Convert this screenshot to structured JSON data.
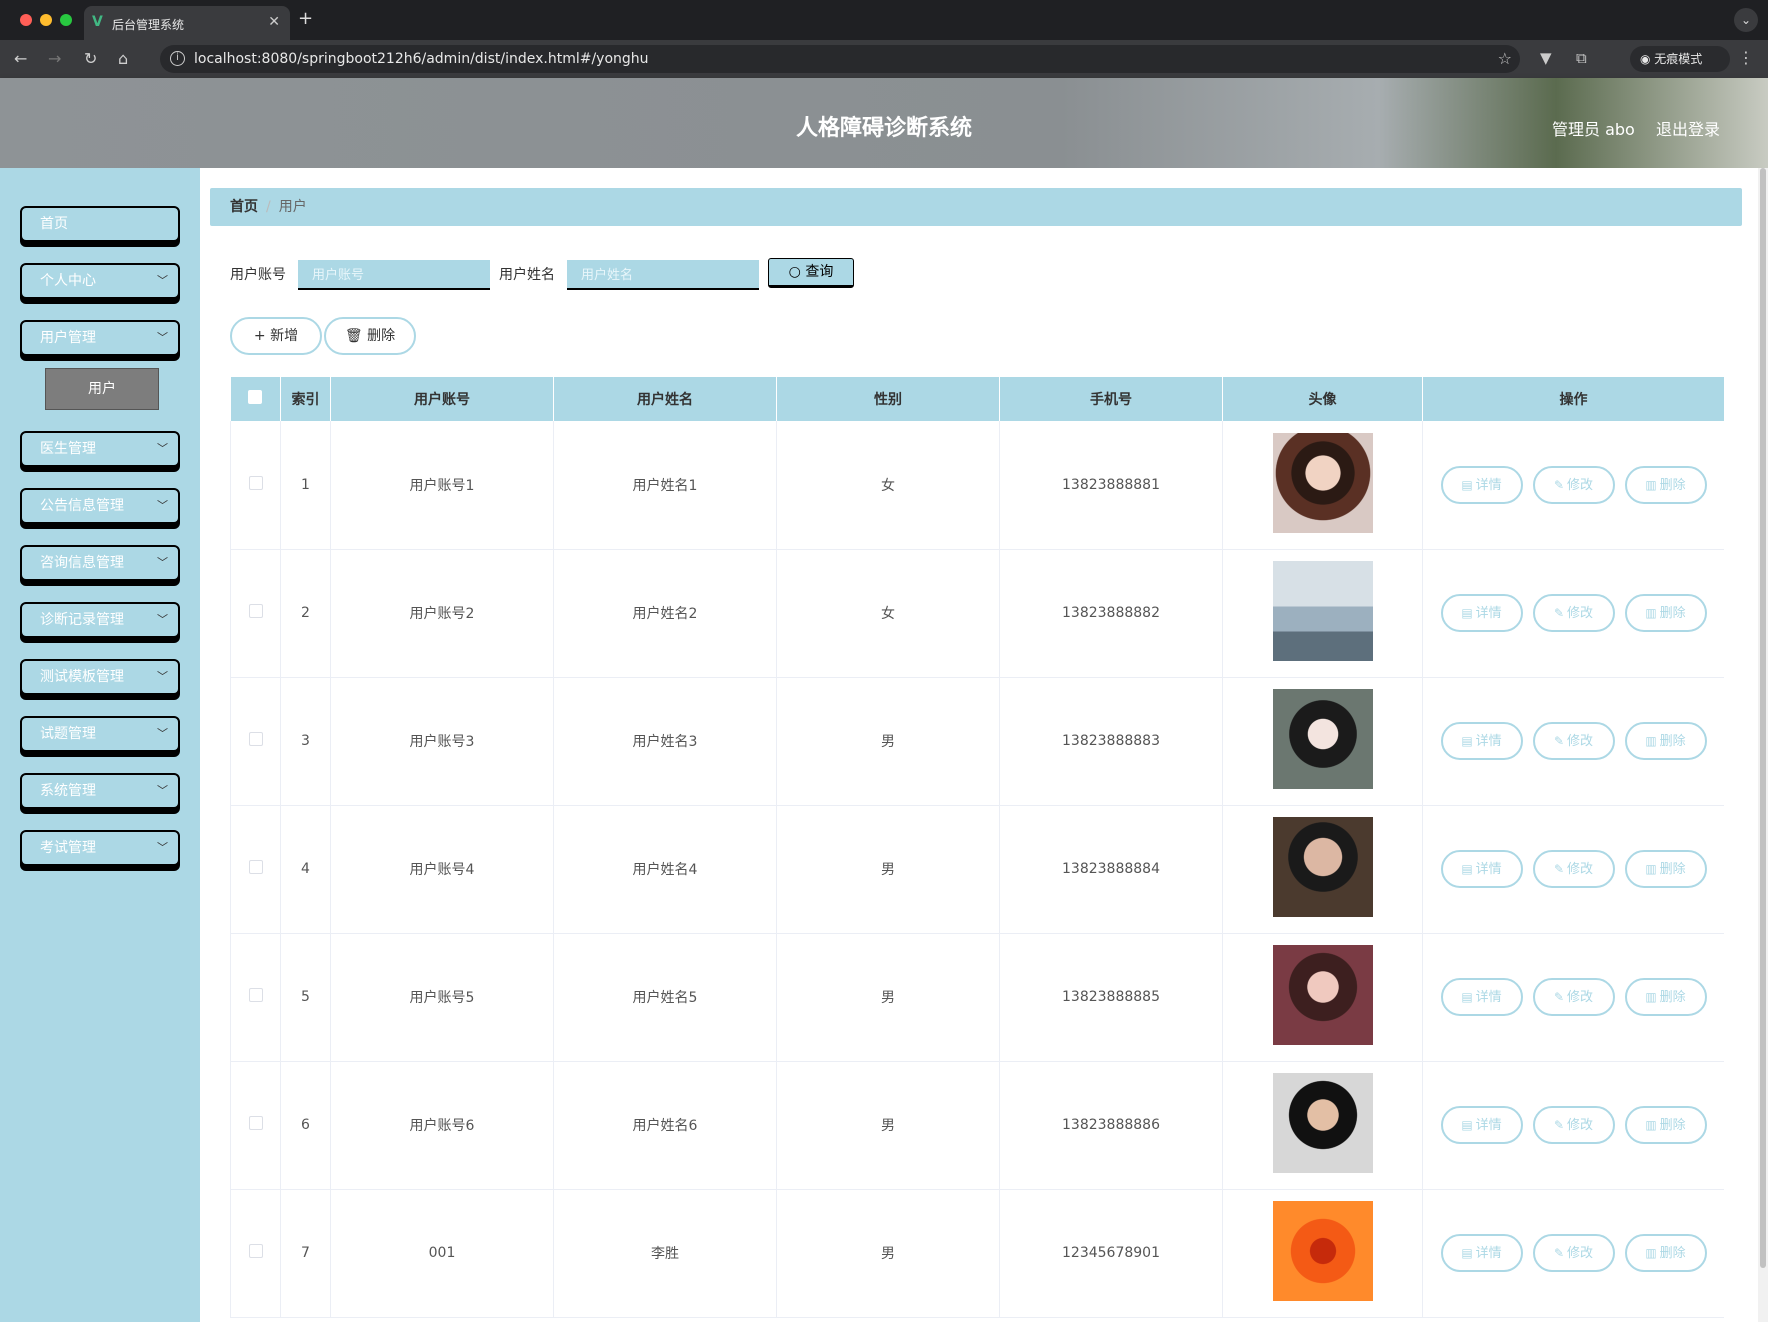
{
  "browser": {
    "tab_title": "后台管理系统",
    "url": "localhost:8080/springboot212h6/admin/dist/index.html#/yonghu",
    "incognito_label": "无痕模式"
  },
  "header": {
    "title": "人格障碍诊断系统",
    "admin_label": "管理员 abo",
    "logout_label": "退出登录"
  },
  "sidebar": {
    "items": [
      {
        "label": "首页"
      },
      {
        "label": "个人中心"
      },
      {
        "label": "用户管理"
      },
      {
        "label": "医生管理"
      },
      {
        "label": "公告信息管理"
      },
      {
        "label": "咨询信息管理"
      },
      {
        "label": "诊断记录管理"
      },
      {
        "label": "测试模板管理"
      },
      {
        "label": "试题管理"
      },
      {
        "label": "系统管理"
      },
      {
        "label": "考试管理"
      }
    ],
    "submenu_label": "用户"
  },
  "breadcrumb": {
    "home": "首页",
    "current": "用户"
  },
  "search": {
    "account_label": "用户账号",
    "account_placeholder": "用户账号",
    "name_label": "用户姓名",
    "name_placeholder": "用户姓名",
    "query_label": "查询"
  },
  "actions": {
    "add_label": "新增",
    "delete_label": "删除"
  },
  "table": {
    "headers": [
      "索引",
      "用户账号",
      "用户姓名",
      "性别",
      "手机号",
      "头像",
      "操作"
    ],
    "op_labels": {
      "detail": "详情",
      "edit": "修改",
      "delete": "删除"
    },
    "rows": [
      {
        "index": "1",
        "account": "用户账号1",
        "name": "用户姓名1",
        "gender": "女",
        "phone": "13823888881"
      },
      {
        "index": "2",
        "account": "用户账号2",
        "name": "用户姓名2",
        "gender": "女",
        "phone": "13823888882"
      },
      {
        "index": "3",
        "account": "用户账号3",
        "name": "用户姓名3",
        "gender": "男",
        "phone": "13823888883"
      },
      {
        "index": "4",
        "account": "用户账号4",
        "name": "用户姓名4",
        "gender": "男",
        "phone": "13823888884"
      },
      {
        "index": "5",
        "account": "用户账号5",
        "name": "用户姓名5",
        "gender": "男",
        "phone": "13823888885"
      },
      {
        "index": "6",
        "account": "用户账号6",
        "name": "用户姓名6",
        "gender": "男",
        "phone": "13823888886"
      },
      {
        "index": "7",
        "account": "001",
        "name": "李胜",
        "gender": "男",
        "phone": "12345678901"
      }
    ]
  },
  "colors": {
    "accent": "#acd8e5",
    "header_bg": "#8e9396",
    "sidebar_bg": "#acd8e5"
  }
}
